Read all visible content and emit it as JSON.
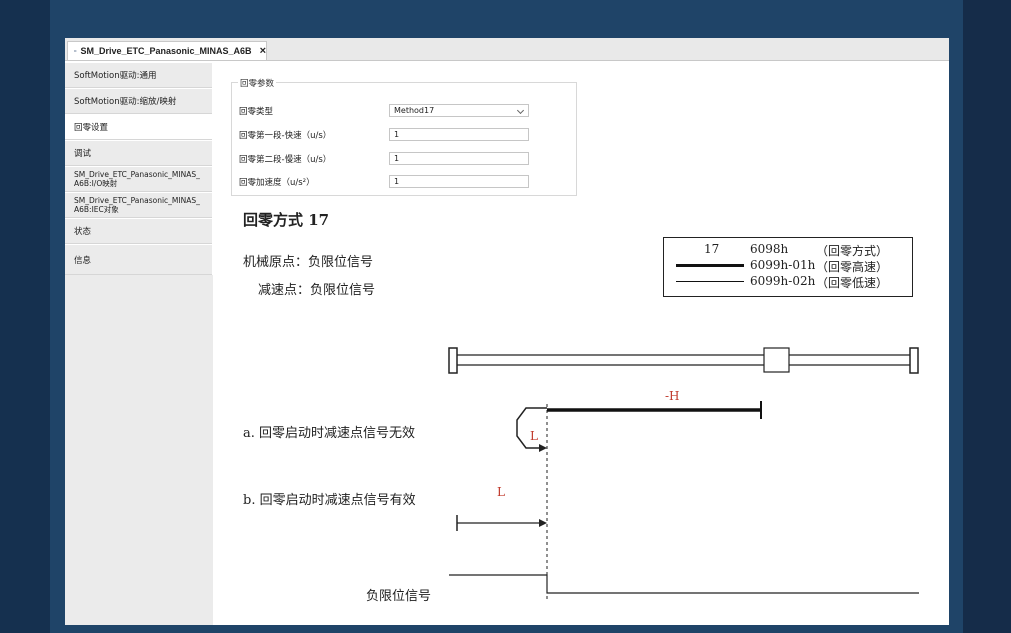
{
  "tab": {
    "title": "SM_Drive_ETC_Panasonic_MINAS_A6B",
    "close": "×"
  },
  "sidebar": {
    "items": [
      {
        "label": "SoftMotion驱动:通用"
      },
      {
        "label": "SoftMotion驱动:缩放/映射"
      },
      {
        "label": "回零设置"
      },
      {
        "label": "调试"
      },
      {
        "label": "SM_Drive_ETC_Panasonic_MINAS_\nA6B:I/O映射"
      },
      {
        "label": "SM_Drive_ETC_Panasonic_MINAS_\nA6B:IEC对象"
      },
      {
        "label": "状态"
      },
      {
        "label": "信息"
      }
    ]
  },
  "homing": {
    "group_title": "回零参数",
    "params": [
      {
        "label": "回零类型",
        "value": "Method17"
      },
      {
        "label": "回零第一段-快速（u/s）",
        "value": "1"
      },
      {
        "label": "回零第二段-慢速（u/s）",
        "value": "1"
      },
      {
        "label": "回零加速度（u/s²）",
        "value": "1"
      }
    ]
  },
  "diagram": {
    "title": "回零方式 17",
    "origin": "机械原点：负限位信号",
    "decel": "减速点：负限位信号",
    "legend": {
      "method_num": "17",
      "row1_code": "6098h",
      "row1_desc": "（回零方式）",
      "row2_code": "6099h-01h",
      "row2_desc": "（回零高速）",
      "row3_code": "6099h-02h",
      "row3_desc": "（回零低速）"
    },
    "case_a": "a. 回零启动时减速点信号无效",
    "case_b": "b. 回零启动时减速点信号有效",
    "label_h": "-H",
    "label_l": "L",
    "neg_limit": "负限位信号"
  },
  "colors": {
    "accent_red": "#c0392b"
  }
}
